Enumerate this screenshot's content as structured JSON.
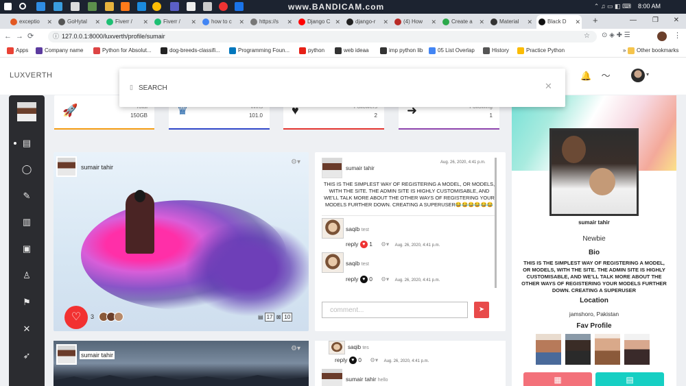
{
  "watermark": "www.BANDICAM.com",
  "clock": "8:00 AM",
  "tabs": [
    {
      "label": "exceptio",
      "color": "#e25822"
    },
    {
      "label": "GoHytal",
      "color": "#555"
    },
    {
      "label": "Fiverr / ",
      "color": "#1dbf73"
    },
    {
      "label": "Fiverr / ",
      "color": "#1dbf73"
    },
    {
      "label": "how to c",
      "color": "#4285f4"
    },
    {
      "label": "https://s",
      "color": "#777"
    },
    {
      "label": "Django C",
      "color": "#ff0000"
    },
    {
      "label": "django-r",
      "color": "#222"
    },
    {
      "label": "(4) How",
      "color": "#b92b27"
    },
    {
      "label": "Create a",
      "color": "#2ba84a"
    },
    {
      "label": "Material",
      "color": "#333"
    },
    {
      "label": "Black D",
      "color": "#111"
    }
  ],
  "address": {
    "url": "127.0.0.1:8000/luxverth/profile/sumair"
  },
  "bookmarks": [
    {
      "label": "Apps",
      "color": "#e94235"
    },
    {
      "label": "Company name",
      "color": "#5c3b9f"
    },
    {
      "label": "Python for Absolut...",
      "color": "#d44"
    },
    {
      "label": "dog-breeds-classifi...",
      "color": "#222"
    },
    {
      "label": "Programming Foun...",
      "color": "#0277bd"
    },
    {
      "label": "python",
      "color": "#e62117"
    },
    {
      "label": "web ideaa",
      "color": "#333"
    },
    {
      "label": "imp python lib",
      "color": "#333"
    },
    {
      "label": "05 List Overlap",
      "color": "#4285f4"
    },
    {
      "label": "History",
      "color": "#555"
    },
    {
      "label": "Practice Python",
      "color": "#fbbc05"
    }
  ],
  "other_bookmarks": "Other bookmarks",
  "brand": "LUXVERTH",
  "search": {
    "placeholder": "SEARCH"
  },
  "stats": [
    {
      "label": "Total",
      "value": "150GB",
      "bar": "#f39c12"
    },
    {
      "label": "Wins",
      "value": "101.0",
      "bar": "#3047c9"
    },
    {
      "label": "Followers",
      "value": "2",
      "bar": "#e3342f"
    },
    {
      "label": "Following",
      "value": "1",
      "bar": "#8e44ad"
    }
  ],
  "post1": {
    "author": "sumair tahir",
    "likes": "3",
    "stat_a": "17",
    "stat_b": "10"
  },
  "post_comment": {
    "author": "sumair tahir",
    "date": "Aug. 26, 2020, 4:41 p.m.",
    "text": "THIS IS THE SIMPLEST WAY OF REGISTERING A MODEL, OR MODELS, WITH THE SITE. THE ADMIN SITE IS HIGHLY CUSTOMISABLE, AND WE’LL TALK MORE ABOUT THE OTHER WAYS OF REGISTERING YOUR MODELS FURTHER DOWN. CREATING A SUPERUSER😂😂😂😂😂😂"
  },
  "replies": [
    {
      "name": "saqib",
      "text": "test",
      "reply": "reply",
      "likes": "1",
      "date": "Aug. 26, 2020, 4:41 p.m."
    },
    {
      "name": "saqib",
      "text": "test",
      "reply": "reply",
      "likes": "0",
      "date": "Aug. 26, 2020, 4:41 p.m."
    }
  ],
  "comment_input": {
    "placeholder": "comment..."
  },
  "post2": {
    "author": "sumair tahir"
  },
  "post2_comments": {
    "reply_name": "saqib",
    "reply_text": "tes",
    "reply_label": "reply",
    "reply_likes": "0",
    "reply_date": "Aug. 26, 2020, 4:41 p.m.",
    "author": "sumair tahir",
    "author_text": "hello"
  },
  "profile": {
    "name": "sumair tahir",
    "rank": "Newbie",
    "bio_heading": "Bio",
    "bio": "THIS IS THE SIMPLEST WAY OF REGISTERING A MODEL, OR MODELS, WITH THE SITE. THE ADMIN SITE IS HIGHLY CUSTOMISABLE, AND WE’LL TALK MORE ABOUT THE OTHER WAYS OF REGISTERING YOUR MODELS FURTHER DOWN. CREATING A SUPERUSER",
    "location_heading": "Location",
    "location": "jamshoro, Pakistan",
    "fav_heading": "Fav Profile"
  }
}
